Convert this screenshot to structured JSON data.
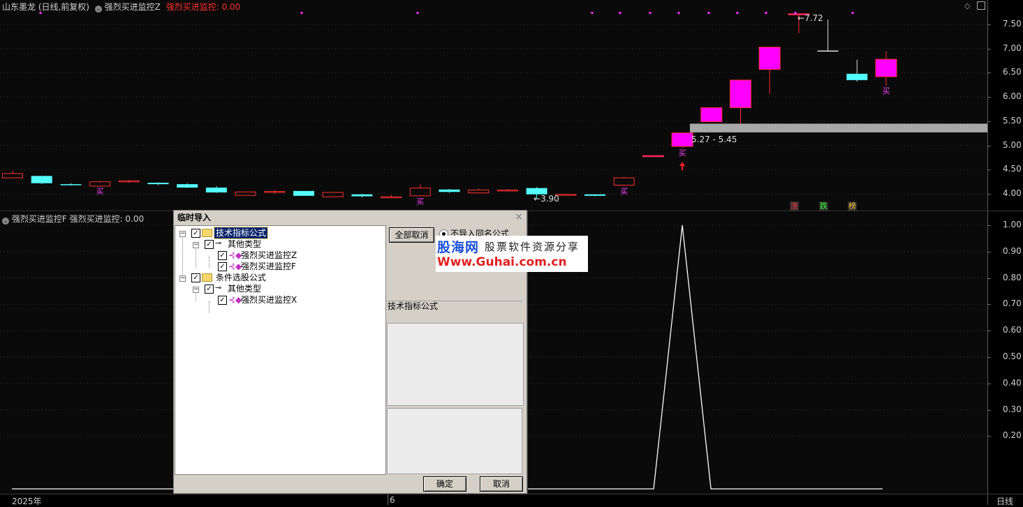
{
  "top_header": {
    "stock": "山东墨龙 (日线,前复权)",
    "indicator": "强烈买进监控Z",
    "indicator_value": "强烈买进监控: 0.00"
  },
  "bottom_header": {
    "indicator": "强烈买进监控F",
    "indicator_value": "强烈买进监控: 0.00"
  },
  "price_axis": [
    "7.50",
    "7.00",
    "6.50",
    "6.00",
    "5.50",
    "5.00",
    "4.50",
    "4.00"
  ],
  "indicator_axis": [
    "1.00",
    "0.90",
    "0.80",
    "0.70",
    "0.60",
    "0.50",
    "0.40",
    "0.30",
    "0.20"
  ],
  "annotations": {
    "high": "7.72",
    "low": "3.90",
    "zone": "5.27 - 5.45",
    "buy_mark": "买"
  },
  "badges": [
    {
      "label": "涨",
      "color": "#ff4040"
    },
    {
      "label": "跌",
      "color": "#40ff40"
    },
    {
      "label": "榜",
      "color": "#ffcc40"
    }
  ],
  "time_axis": {
    "year": "2025年",
    "month": "6",
    "period": "日线"
  },
  "dialog": {
    "title": "临时导入",
    "tree": {
      "root1": "技术指标公式",
      "root1_child": "其他类型",
      "leaf1": "强烈买进监控Z",
      "leaf2": "强烈买进监控F",
      "root2": "条件选股公式",
      "root2_child": "其他类型",
      "leaf3": "强烈买进监控X"
    },
    "cancel_all": "全部取消",
    "radio_label": "不导入同名公式",
    "info_label": "技术指标公式",
    "ok": "确定",
    "cancel": "取消"
  },
  "watermark": {
    "brand": "股海网",
    "slogan": "股票软件资源分享",
    "url": "Www.Guhai.com.cn"
  },
  "chart_data": {
    "type": "candlestick",
    "price_ylim": [
      3.8,
      7.8
    ],
    "candles": [
      {
        "o": 4.33,
        "c": 4.42,
        "h": 4.48,
        "l": 4.33,
        "up": true
      },
      {
        "o": 4.37,
        "c": 4.22,
        "h": 4.37,
        "l": 4.2,
        "up": false
      },
      {
        "o": 4.2,
        "c": 4.19,
        "h": 4.22,
        "l": 4.17,
        "up": false
      },
      {
        "o": 4.16,
        "c": 4.25,
        "h": 4.27,
        "l": 4.16,
        "up": true
      },
      {
        "o": 4.25,
        "c": 4.27,
        "h": 4.29,
        "l": 4.23,
        "up": true
      },
      {
        "o": 4.23,
        "c": 4.2,
        "h": 4.24,
        "l": 4.18,
        "up": false
      },
      {
        "o": 4.2,
        "c": 4.13,
        "h": 4.22,
        "l": 4.12,
        "up": false
      },
      {
        "o": 4.13,
        "c": 4.03,
        "h": 4.16,
        "l": 4.02,
        "up": false
      },
      {
        "o": 3.97,
        "c": 4.04,
        "h": 4.05,
        "l": 3.97,
        "up": true
      },
      {
        "o": 4.03,
        "c": 4.05,
        "h": 4.08,
        "l": 4.0,
        "up": true
      },
      {
        "o": 4.06,
        "c": 3.96,
        "h": 4.06,
        "l": 3.96,
        "up": false
      },
      {
        "o": 3.94,
        "c": 4.03,
        "h": 4.03,
        "l": 3.94,
        "up": true
      },
      {
        "o": 3.99,
        "c": 3.95,
        "h": 4.0,
        "l": 3.93,
        "up": false
      },
      {
        "o": 3.92,
        "c": 3.94,
        "h": 3.98,
        "l": 3.91,
        "up": true
      },
      {
        "o": 3.96,
        "c": 4.12,
        "h": 4.2,
        "l": 3.95,
        "up": true
      },
      {
        "o": 4.09,
        "c": 4.04,
        "h": 4.1,
        "l": 4.02,
        "up": false
      },
      {
        "o": 4.02,
        "c": 4.08,
        "h": 4.11,
        "l": 4.01,
        "up": true
      },
      {
        "o": 4.07,
        "c": 4.08,
        "h": 4.1,
        "l": 4.06,
        "up": true
      },
      {
        "o": 4.12,
        "c": 3.99,
        "h": 4.14,
        "l": 3.9,
        "up": false
      },
      {
        "o": 3.98,
        "c": 3.99,
        "h": 3.99,
        "l": 3.97,
        "up": true
      },
      {
        "o": 3.99,
        "c": 3.96,
        "h": 3.99,
        "l": 3.95,
        "up": false
      },
      {
        "o": 4.18,
        "c": 4.33,
        "h": 4.35,
        "l": 4.16,
        "up": true
      },
      {
        "o": 4.78,
        "c": 4.79,
        "h": 4.79,
        "l": 4.78,
        "up": true
      },
      {
        "o": 4.98,
        "c": 5.26,
        "h": 5.26,
        "l": 4.95,
        "up": true
      },
      {
        "o": 5.49,
        "c": 5.78,
        "h": 5.78,
        "l": 5.49,
        "up": true
      },
      {
        "o": 5.78,
        "c": 6.35,
        "h": 6.35,
        "l": 5.45,
        "up": true
      },
      {
        "o": 6.57,
        "c": 7.03,
        "h": 7.03,
        "l": 6.07,
        "up": true
      },
      {
        "o": 7.7,
        "c": 7.72,
        "h": 7.72,
        "l": 7.32,
        "up": true
      },
      {
        "o": 6.96,
        "c": 6.95,
        "h": 7.6,
        "l": 6.95,
        "up": false
      },
      {
        "o": 6.48,
        "c": 6.35,
        "h": 6.77,
        "l": 6.32,
        "up": false
      },
      {
        "o": 6.42,
        "c": 6.78,
        "h": 6.95,
        "l": 6.23,
        "up": true
      }
    ],
    "zone": {
      "low": 5.27,
      "high": 5.45
    },
    "indicator_ylim": [
      0,
      1.05
    ],
    "indicator_values": [
      0,
      0,
      0,
      0,
      0,
      0,
      0,
      0,
      0,
      0,
      0,
      0,
      0,
      0,
      0,
      0,
      0,
      0,
      0,
      0,
      0,
      0,
      0,
      1,
      0,
      0,
      0,
      0,
      0,
      0,
      0
    ]
  }
}
